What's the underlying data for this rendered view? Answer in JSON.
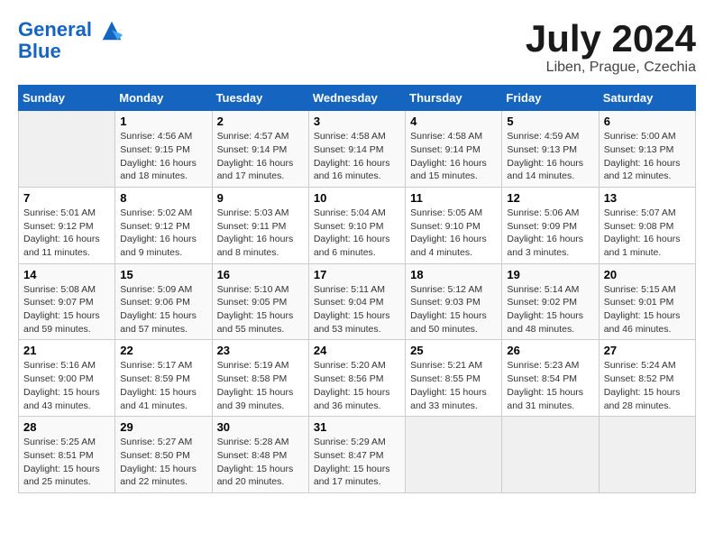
{
  "header": {
    "logo_line1": "General",
    "logo_line2": "Blue",
    "title": "July 2024",
    "subtitle": "Liben, Prague, Czechia"
  },
  "columns": [
    "Sunday",
    "Monday",
    "Tuesday",
    "Wednesday",
    "Thursday",
    "Friday",
    "Saturday"
  ],
  "weeks": [
    [
      {
        "num": "",
        "info": ""
      },
      {
        "num": "1",
        "info": "Sunrise: 4:56 AM\nSunset: 9:15 PM\nDaylight: 16 hours\nand 18 minutes."
      },
      {
        "num": "2",
        "info": "Sunrise: 4:57 AM\nSunset: 9:14 PM\nDaylight: 16 hours\nand 17 minutes."
      },
      {
        "num": "3",
        "info": "Sunrise: 4:58 AM\nSunset: 9:14 PM\nDaylight: 16 hours\nand 16 minutes."
      },
      {
        "num": "4",
        "info": "Sunrise: 4:58 AM\nSunset: 9:14 PM\nDaylight: 16 hours\nand 15 minutes."
      },
      {
        "num": "5",
        "info": "Sunrise: 4:59 AM\nSunset: 9:13 PM\nDaylight: 16 hours\nand 14 minutes."
      },
      {
        "num": "6",
        "info": "Sunrise: 5:00 AM\nSunset: 9:13 PM\nDaylight: 16 hours\nand 12 minutes."
      }
    ],
    [
      {
        "num": "7",
        "info": "Sunrise: 5:01 AM\nSunset: 9:12 PM\nDaylight: 16 hours\nand 11 minutes."
      },
      {
        "num": "8",
        "info": "Sunrise: 5:02 AM\nSunset: 9:12 PM\nDaylight: 16 hours\nand 9 minutes."
      },
      {
        "num": "9",
        "info": "Sunrise: 5:03 AM\nSunset: 9:11 PM\nDaylight: 16 hours\nand 8 minutes."
      },
      {
        "num": "10",
        "info": "Sunrise: 5:04 AM\nSunset: 9:10 PM\nDaylight: 16 hours\nand 6 minutes."
      },
      {
        "num": "11",
        "info": "Sunrise: 5:05 AM\nSunset: 9:10 PM\nDaylight: 16 hours\nand 4 minutes."
      },
      {
        "num": "12",
        "info": "Sunrise: 5:06 AM\nSunset: 9:09 PM\nDaylight: 16 hours\nand 3 minutes."
      },
      {
        "num": "13",
        "info": "Sunrise: 5:07 AM\nSunset: 9:08 PM\nDaylight: 16 hours\nand 1 minute."
      }
    ],
    [
      {
        "num": "14",
        "info": "Sunrise: 5:08 AM\nSunset: 9:07 PM\nDaylight: 15 hours\nand 59 minutes."
      },
      {
        "num": "15",
        "info": "Sunrise: 5:09 AM\nSunset: 9:06 PM\nDaylight: 15 hours\nand 57 minutes."
      },
      {
        "num": "16",
        "info": "Sunrise: 5:10 AM\nSunset: 9:05 PM\nDaylight: 15 hours\nand 55 minutes."
      },
      {
        "num": "17",
        "info": "Sunrise: 5:11 AM\nSunset: 9:04 PM\nDaylight: 15 hours\nand 53 minutes."
      },
      {
        "num": "18",
        "info": "Sunrise: 5:12 AM\nSunset: 9:03 PM\nDaylight: 15 hours\nand 50 minutes."
      },
      {
        "num": "19",
        "info": "Sunrise: 5:14 AM\nSunset: 9:02 PM\nDaylight: 15 hours\nand 48 minutes."
      },
      {
        "num": "20",
        "info": "Sunrise: 5:15 AM\nSunset: 9:01 PM\nDaylight: 15 hours\nand 46 minutes."
      }
    ],
    [
      {
        "num": "21",
        "info": "Sunrise: 5:16 AM\nSunset: 9:00 PM\nDaylight: 15 hours\nand 43 minutes."
      },
      {
        "num": "22",
        "info": "Sunrise: 5:17 AM\nSunset: 8:59 PM\nDaylight: 15 hours\nand 41 minutes."
      },
      {
        "num": "23",
        "info": "Sunrise: 5:19 AM\nSunset: 8:58 PM\nDaylight: 15 hours\nand 39 minutes."
      },
      {
        "num": "24",
        "info": "Sunrise: 5:20 AM\nSunset: 8:56 PM\nDaylight: 15 hours\nand 36 minutes."
      },
      {
        "num": "25",
        "info": "Sunrise: 5:21 AM\nSunset: 8:55 PM\nDaylight: 15 hours\nand 33 minutes."
      },
      {
        "num": "26",
        "info": "Sunrise: 5:23 AM\nSunset: 8:54 PM\nDaylight: 15 hours\nand 31 minutes."
      },
      {
        "num": "27",
        "info": "Sunrise: 5:24 AM\nSunset: 8:52 PM\nDaylight: 15 hours\nand 28 minutes."
      }
    ],
    [
      {
        "num": "28",
        "info": "Sunrise: 5:25 AM\nSunset: 8:51 PM\nDaylight: 15 hours\nand 25 minutes."
      },
      {
        "num": "29",
        "info": "Sunrise: 5:27 AM\nSunset: 8:50 PM\nDaylight: 15 hours\nand 22 minutes."
      },
      {
        "num": "30",
        "info": "Sunrise: 5:28 AM\nSunset: 8:48 PM\nDaylight: 15 hours\nand 20 minutes."
      },
      {
        "num": "31",
        "info": "Sunrise: 5:29 AM\nSunset: 8:47 PM\nDaylight: 15 hours\nand 17 minutes."
      },
      {
        "num": "",
        "info": ""
      },
      {
        "num": "",
        "info": ""
      },
      {
        "num": "",
        "info": ""
      }
    ]
  ]
}
